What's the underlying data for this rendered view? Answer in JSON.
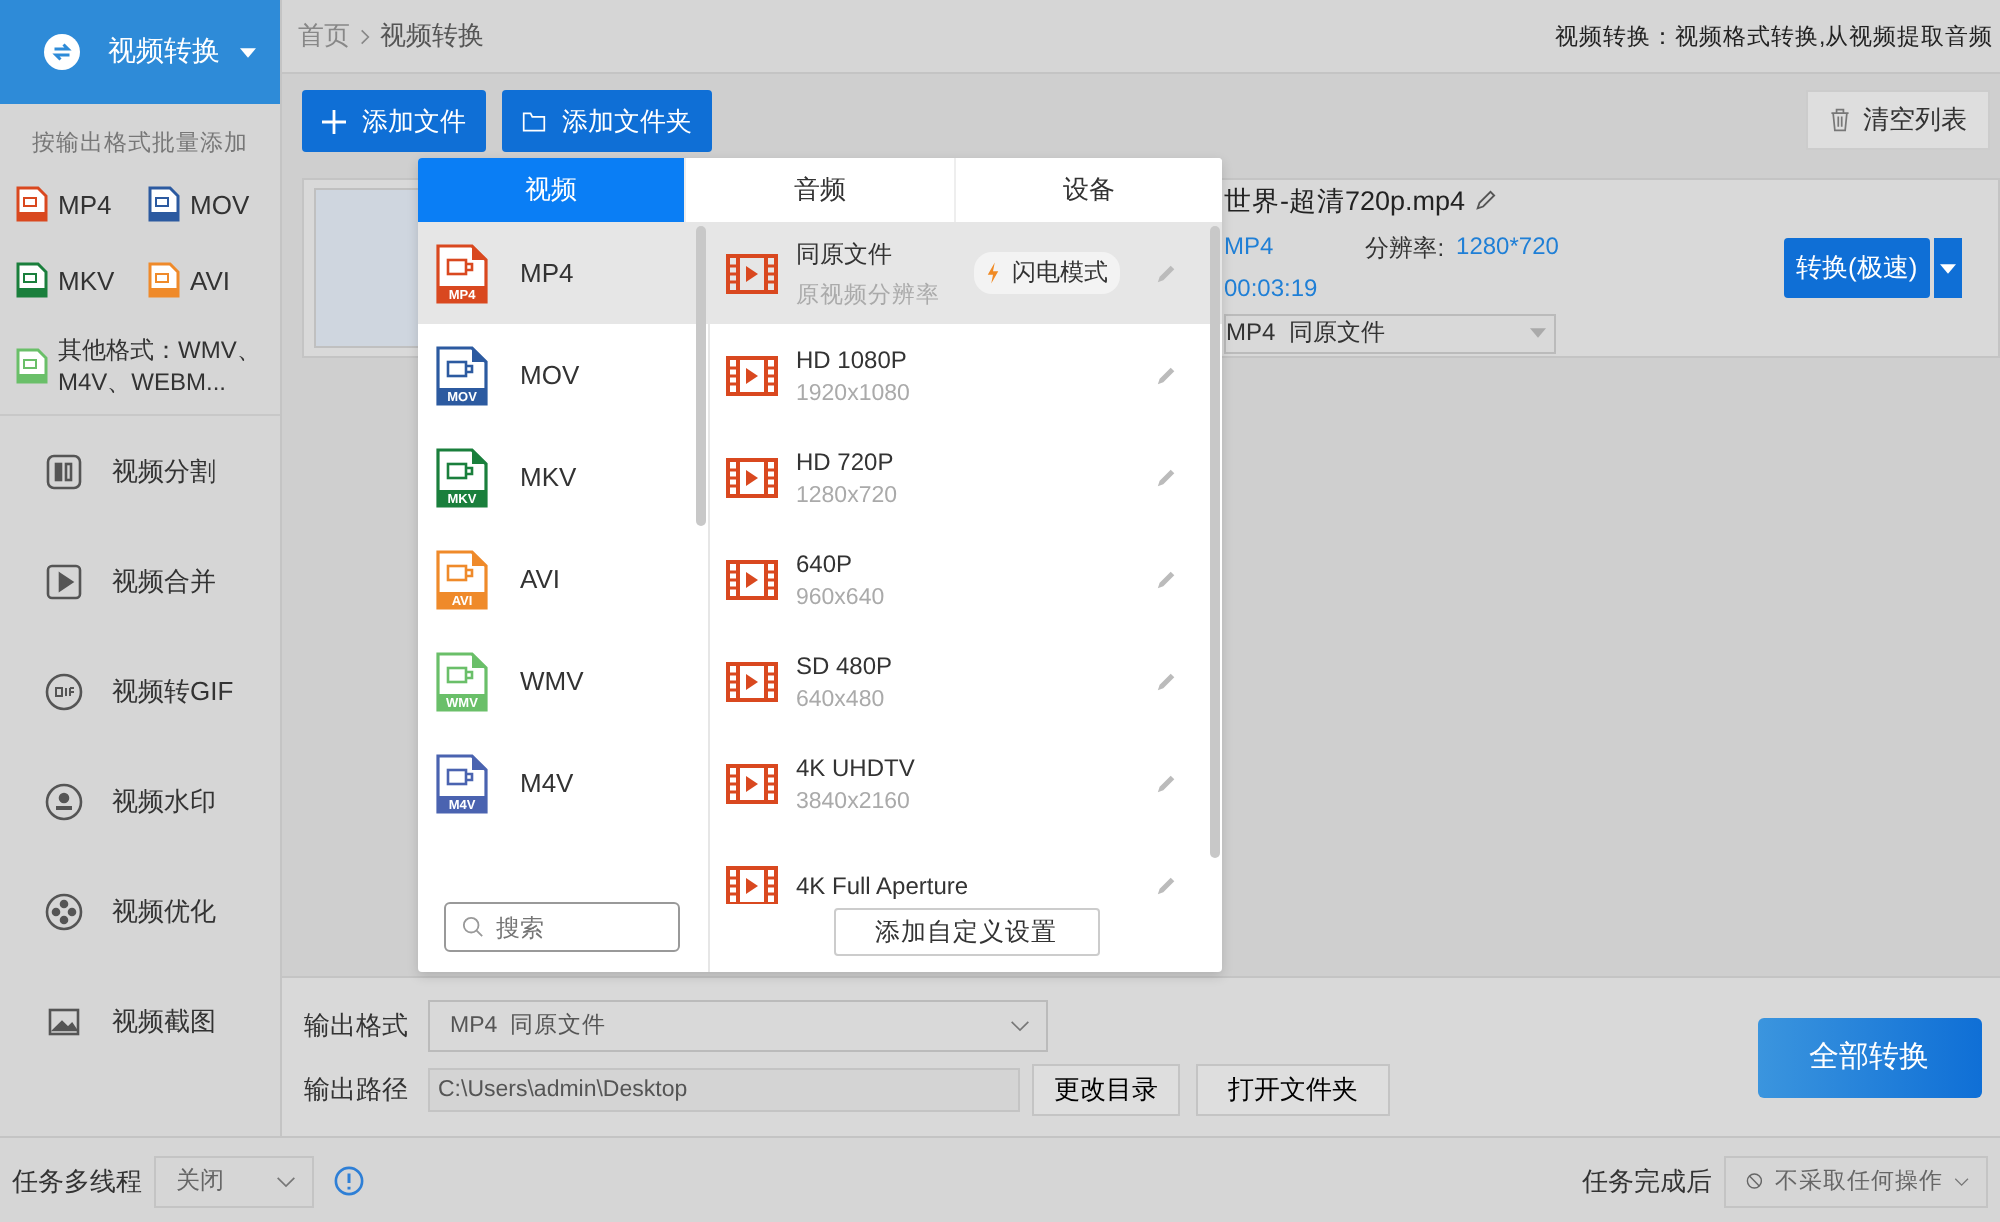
{
  "sidebar": {
    "header": "视频转换",
    "batch_hint": "按输出格式批量添加",
    "formats": [
      {
        "label": "MP4",
        "color": "#d9481f"
      },
      {
        "label": "MOV",
        "color": "#2c5aa0"
      },
      {
        "label": "MKV",
        "color": "#1a7f3c"
      },
      {
        "label": "AVI",
        "color": "#ef8a2a"
      }
    ],
    "other_formats": {
      "label": "其他格式：WMV、M4V、WEBM...",
      "color": "#6abf69"
    },
    "tools": [
      {
        "label": "视频分割",
        "kind": "split"
      },
      {
        "label": "视频合并",
        "kind": "merge"
      },
      {
        "label": "视频转GIF",
        "kind": "gif"
      },
      {
        "label": "视频水印",
        "kind": "watermark"
      },
      {
        "label": "视频优化",
        "kind": "optimize"
      },
      {
        "label": "视频截图",
        "kind": "screenshot"
      }
    ]
  },
  "breadcrumb": {
    "home": "首页",
    "current": "视频转换"
  },
  "description": "视频转换：视频格式转换,从视频提取音频",
  "toolbar": {
    "add_file": "添加文件",
    "add_folder": "添加文件夹",
    "clear": "清空列表"
  },
  "file": {
    "name": "世界-超清720p.mp4",
    "format": "MP4",
    "duration": "00:03:19",
    "resolution_label": "分辨率:",
    "resolution": "1280*720",
    "output": "MP4  同原文件",
    "convert": "转换(极速)"
  },
  "popup": {
    "tabs": [
      {
        "label": "视频",
        "selected": true
      },
      {
        "label": "音频",
        "selected": false
      },
      {
        "label": "设备",
        "selected": false
      }
    ],
    "formats": [
      {
        "label": "MP4",
        "badge": "MP4",
        "color": "#d9481f",
        "selected": true
      },
      {
        "label": "MOV",
        "badge": "MOV",
        "color": "#2c5aa0",
        "selected": false
      },
      {
        "label": "MKV",
        "badge": "MKV",
        "color": "#1a7f3c",
        "selected": false
      },
      {
        "label": "AVI",
        "badge": "AVI",
        "color": "#ef8a2a",
        "selected": false
      },
      {
        "label": "WMV",
        "badge": "WMV",
        "color": "#6abf69",
        "selected": false
      },
      {
        "label": "M4V",
        "badge": "M4V",
        "color": "#4a63b0",
        "selected": false
      }
    ],
    "search_placeholder": "搜索",
    "presets": [
      {
        "name": "同原文件",
        "detail": "原视频分辨率",
        "badge": "闪电模式",
        "selected": true
      },
      {
        "name": "HD 1080P",
        "detail": "1920x1080",
        "selected": false
      },
      {
        "name": "HD 720P",
        "detail": "1280x720",
        "selected": false
      },
      {
        "name": "640P",
        "detail": "960x640",
        "selected": false
      },
      {
        "name": "SD 480P",
        "detail": "640x480",
        "selected": false
      },
      {
        "name": "4K UHDTV",
        "detail": "3840x2160",
        "selected": false
      },
      {
        "name": "4K Full Aperture",
        "selected": false
      }
    ],
    "add_custom": "添加自定义设置"
  },
  "output": {
    "format_label": "输出格式",
    "format_value": "MP4  同原文件",
    "path_label": "输出路径",
    "path_value": "C:\\Users\\admin\\Desktop",
    "change_dir": "更改目录",
    "open_folder": "打开文件夹",
    "convert_all": "全部转换"
  },
  "status": {
    "multithread_label": "任务多线程",
    "multithread_value": "关闭",
    "after_label": "任务完成后",
    "after_value": "不采取任何操作"
  }
}
